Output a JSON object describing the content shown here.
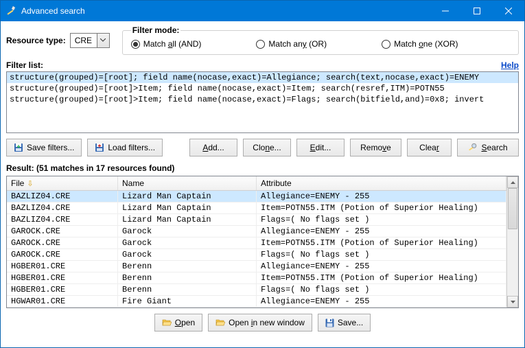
{
  "window": {
    "title": "Advanced search"
  },
  "resourceType": {
    "label": "Resource type:",
    "value": "CRE"
  },
  "filterMode": {
    "legend": "Filter mode:",
    "options": [
      {
        "prefix": "Match ",
        "u": "a",
        "suffix": "ll (AND)",
        "checked": true
      },
      {
        "prefix": "Match an",
        "u": "y",
        "suffix": " (OR)",
        "checked": false
      },
      {
        "prefix": "Match ",
        "u": "o",
        "suffix": "ne (XOR)",
        "checked": false
      }
    ]
  },
  "filterListLabel": "Filter list:",
  "helpLabel": "Help",
  "filters": [
    {
      "text": "structure(grouped)=[root]; field name(nocase,exact)=Allegiance; search(text,nocase,exact)=ENEMY",
      "selected": true
    },
    {
      "text": "structure(grouped)=[root]>Item; field name(nocase,exact)=Item; search(resref,ITM)=POTN55",
      "selected": false
    },
    {
      "text": "structure(grouped)=[root]>Item; field name(nocase,exact)=Flags; search(bitfield,and)=0x8; invert",
      "selected": false
    }
  ],
  "buttons": {
    "saveFilters": "Save filters...",
    "loadFilters": "Load filters...",
    "add_u": "A",
    "add_rest": "dd...",
    "clone_pre": "Clo",
    "clone_u": "n",
    "clone_post": "e...",
    "edit_u": "E",
    "edit_rest": "dit...",
    "remove_pre": "Remo",
    "remove_u": "v",
    "remove_post": "e",
    "clear_pre": "Clea",
    "clear_u": "r",
    "search_u": "S",
    "search_rest": "earch",
    "open_u": "O",
    "open_rest": "pen",
    "openNew_pre": "Open ",
    "openNew_u": "i",
    "openNew_post": "n new window",
    "save": "Save..."
  },
  "resultLabel": "Result:  (51 matches in 17 resources found)",
  "columns": {
    "file": "File",
    "name": "Name",
    "attribute": "Attribute"
  },
  "rows": [
    {
      "file": "BAZLIZ04.CRE",
      "name": "Lizard Man Captain",
      "attr": "Allegiance=ENEMY - 255",
      "sel": true
    },
    {
      "file": "BAZLIZ04.CRE",
      "name": "Lizard Man Captain",
      "attr": "Item=POTN55.ITM (Potion of Superior Healing)"
    },
    {
      "file": "BAZLIZ04.CRE",
      "name": "Lizard Man Captain",
      "attr": "Flags=( No flags set )"
    },
    {
      "file": "GAROCK.CRE",
      "name": "Garock",
      "attr": "Allegiance=ENEMY - 255"
    },
    {
      "file": "GAROCK.CRE",
      "name": "Garock",
      "attr": "Item=POTN55.ITM (Potion of Superior Healing)"
    },
    {
      "file": "GAROCK.CRE",
      "name": "Garock",
      "attr": "Flags=( No flags set )"
    },
    {
      "file": "HGBER01.CRE",
      "name": "Berenn",
      "attr": "Allegiance=ENEMY - 255"
    },
    {
      "file": "HGBER01.CRE",
      "name": "Berenn",
      "attr": "Item=POTN55.ITM (Potion of Superior Healing)"
    },
    {
      "file": "HGBER01.CRE",
      "name": "Berenn",
      "attr": "Flags=( No flags set )"
    },
    {
      "file": "HGWAR01.CRE",
      "name": "Fire Giant",
      "attr": "Allegiance=ENEMY - 255"
    }
  ]
}
